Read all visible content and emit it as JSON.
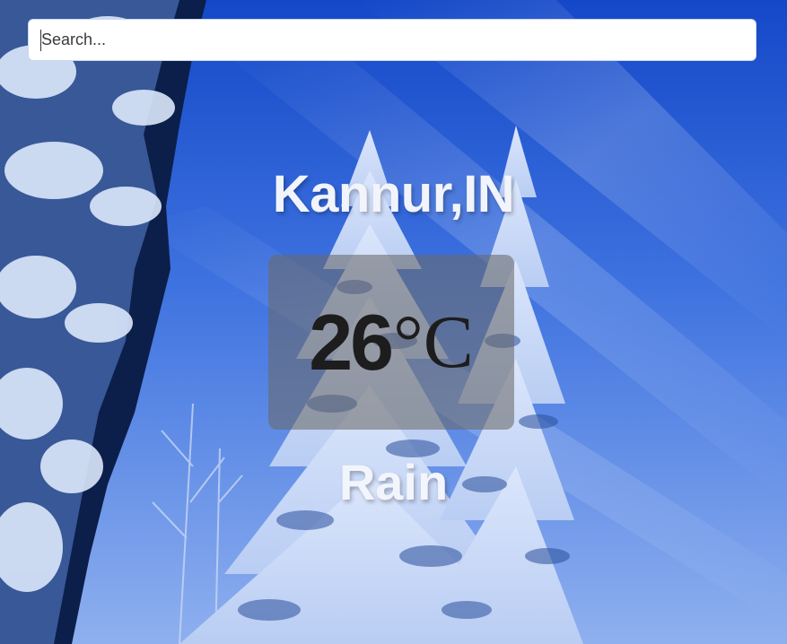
{
  "search": {
    "placeholder": "Search...",
    "value": ""
  },
  "weather": {
    "location": "Kannur,IN",
    "temperature": "26",
    "unit": "°C",
    "condition": "Rain"
  },
  "background": {
    "icon": "snowy-forest-image"
  },
  "colors": {
    "sky_top": "#1448c8",
    "sky_mid": "#3f73e0",
    "sky_bottom": "#8fb0ef",
    "temp_box": "#696969",
    "text_light": "#f2f4fb",
    "text_dark": "#1d1d1d"
  }
}
